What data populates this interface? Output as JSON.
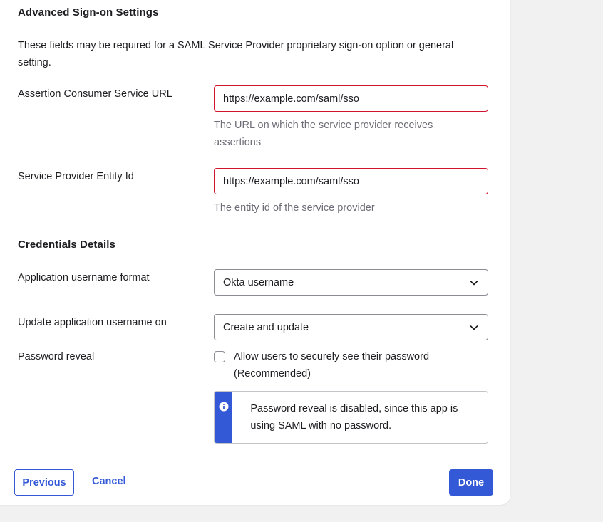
{
  "advanced": {
    "heading": "Advanced Sign-on Settings",
    "description": "These fields may be required for a SAML Service Provider proprietary sign-on option or general setting.",
    "acs_label": "Assertion Consumer Service URL",
    "acs_value": "https://example.com/saml/sso",
    "acs_hint": "The URL on which the service provider receives assertions",
    "entity_label": "Service Provider Entity Id",
    "entity_value": "https://example.com/saml/sso",
    "entity_hint": "The entity id of the service provider"
  },
  "credentials": {
    "heading": "Credentials Details",
    "username_format_label": "Application username format",
    "username_format_value": "Okta username",
    "update_on_label": "Update application username on",
    "update_on_value": "Create and update",
    "password_reveal_label": "Password reveal",
    "password_reveal_checkbox_label": "Allow users to securely see their password (Recommended)",
    "password_reveal_checked": false,
    "callout_icon": "info-icon",
    "callout_text": "Password reveal is disabled, since this app is using SAML with no password."
  },
  "footer": {
    "previous_label": "Previous",
    "cancel_label": "Cancel",
    "done_label": "Done"
  },
  "colors": {
    "accent": "#3359d6",
    "error_border": "#d1142d",
    "hint_text": "#6e6e78",
    "page_background": "#f1f1f1"
  }
}
